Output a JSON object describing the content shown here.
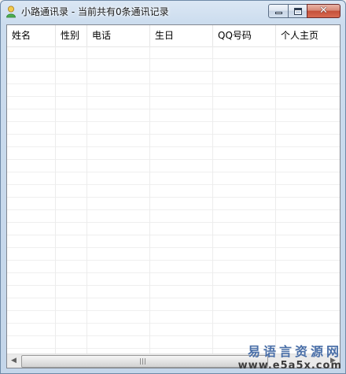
{
  "window": {
    "title": "小路通讯录 - 当前共有0条通讯记录",
    "icon": "contact-person-icon",
    "controls": {
      "minimize_icon": "minimize-icon",
      "maximize_icon": "maximize-icon",
      "close_icon": "close-icon",
      "close_glyph": "✕"
    }
  },
  "table": {
    "columns": [
      "姓名",
      "性别",
      "电话",
      "生日",
      "QQ号码",
      "个人主页"
    ],
    "rows": []
  },
  "scrollbar": {
    "left_arrow": "◀",
    "right_arrow": "▶"
  },
  "watermark": {
    "title": "易语言资源网",
    "url": "www.e5a5x.com"
  },
  "colors": {
    "title_bar": "#c4d6ea",
    "close_button": "#c4503a",
    "watermark_blue": "#4a6fa8"
  }
}
